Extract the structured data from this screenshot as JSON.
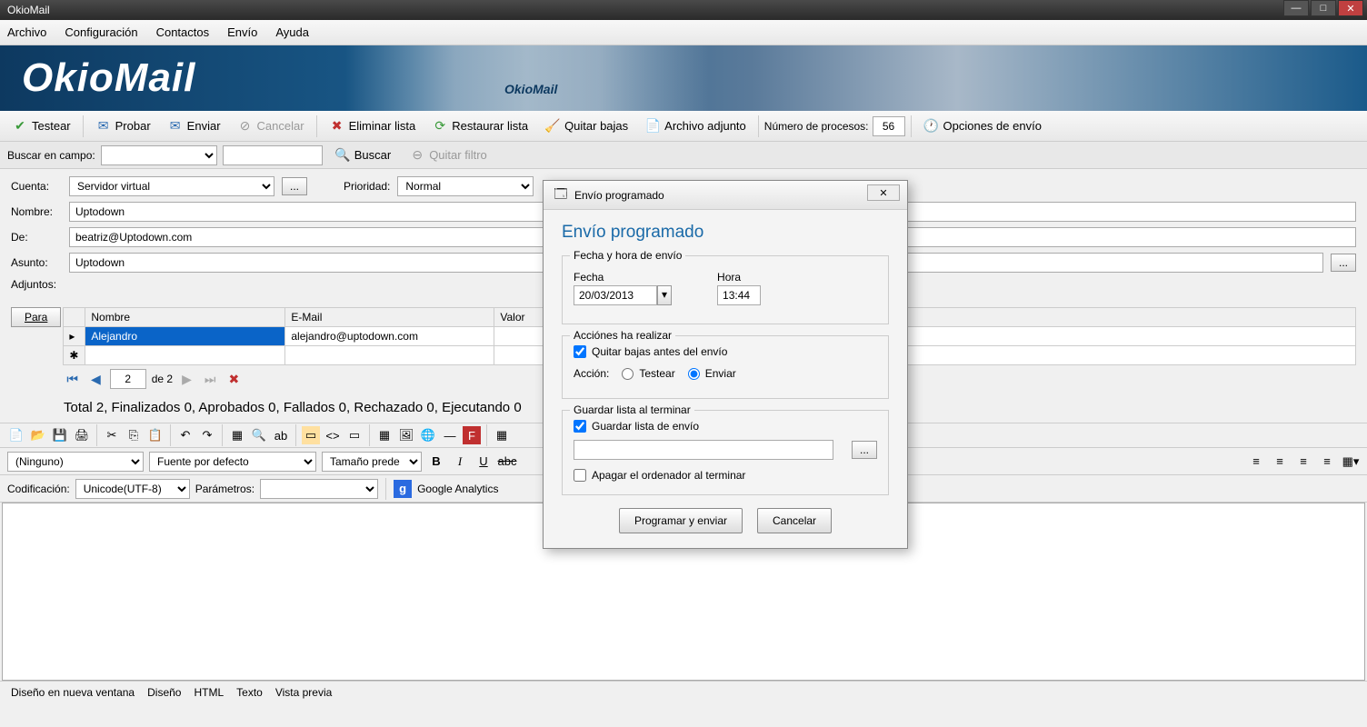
{
  "title": "OkioMail",
  "menu": [
    "Archivo",
    "Configuración",
    "Contactos",
    "Envío",
    "Ayuda"
  ],
  "banner": {
    "text": "OkioMail",
    "train_label": "OkioMail"
  },
  "toolbar": {
    "testear": "Testear",
    "probar": "Probar",
    "enviar": "Enviar",
    "cancelar": "Cancelar",
    "eliminar_lista": "Eliminar lista",
    "restaurar_lista": "Restaurar lista",
    "quitar_bajas": "Quitar bajas",
    "archivo_adjunto": "Archivo adjunto",
    "num_procesos_label": "Número de procesos:",
    "num_procesos_value": "56",
    "opciones_envio": "Opciones de envío"
  },
  "search": {
    "label": "Buscar en campo:",
    "buscar": "Buscar",
    "quitar_filtro": "Quitar filtro"
  },
  "form": {
    "cuenta_label": "Cuenta:",
    "cuenta_value": "Servidor virtual",
    "prioridad_label": "Prioridad:",
    "prioridad_value": "Normal",
    "nombre_label": "Nombre:",
    "nombre_value": "Uptodown",
    "de_label": "De:",
    "de_value": "beatriz@Uptodown.com",
    "asunto_label": "Asunto:",
    "asunto_value": "Uptodown",
    "adjuntos_label": "Adjuntos:",
    "para_btn": "Para"
  },
  "table": {
    "headers": [
      "Nombre",
      "E-Mail",
      "Valor"
    ],
    "rows": [
      {
        "nombre": "Alejandro",
        "email": "alejandro@uptodown.com",
        "valor": ""
      }
    ],
    "page_current": "2",
    "page_total_label": "de 2"
  },
  "status": "Total 2, Finalizados 0, Aprobados 0, Fallados 0, Rechazado 0, Ejecutando 0",
  "editor": {
    "style": "(Ninguno)",
    "font": "Fuente por defecto",
    "size": "Tamaño prede",
    "codificacion_label": "Codificación:",
    "codificacion_value": "Unicode(UTF-8)",
    "parametros_label": "Parámetros:",
    "ga": "Google Analytics"
  },
  "bottom_tabs": [
    "Diseño en nueva ventana",
    "Diseño",
    "HTML",
    "Texto",
    "Vista previa"
  ],
  "dialog": {
    "title": "Envío programado",
    "heading": "Envío programado",
    "fs1_legend": "Fecha y hora de envío",
    "fecha_label": "Fecha",
    "fecha_value": "20/03/2013",
    "hora_label": "Hora",
    "hora_value": "13:44",
    "fs2_legend": "Acciónes ha realizar",
    "quitar_bajas": "Quitar bajas antes del envío",
    "accion_label": "Acción:",
    "accion_testear": "Testear",
    "accion_enviar": "Enviar",
    "fs3_legend": "Guardar lista al terminar",
    "guardar_lista": "Guardar lista de envío",
    "apagar": "Apagar el ordenador al terminar",
    "btn_programar": "Programar y enviar",
    "btn_cancelar": "Cancelar"
  }
}
